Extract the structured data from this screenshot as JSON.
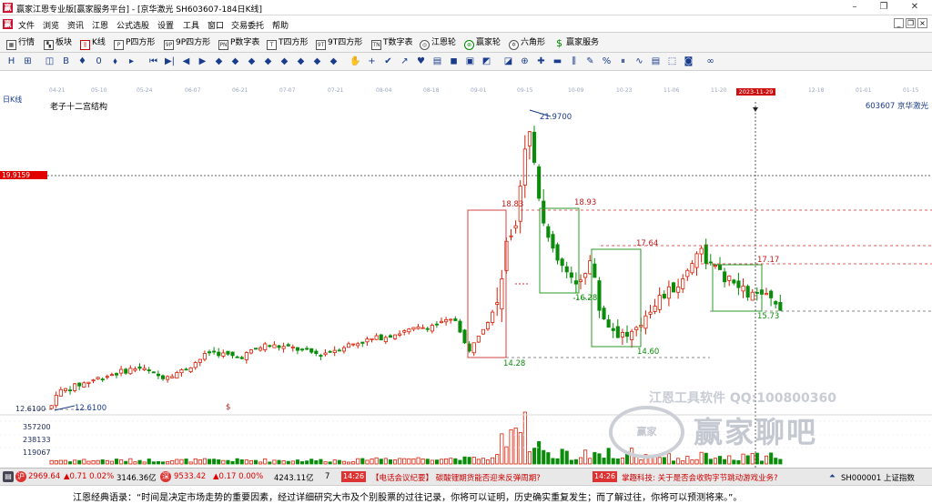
{
  "window": {
    "title": "赢家江恩专业版[赢家服务平台] - [京华激光  SH603607-184日K线]",
    "minimize": "–",
    "restore": "❐",
    "close": "✕"
  },
  "menu": {
    "items": [
      "文件",
      "浏览",
      "资讯",
      "江恩",
      "公式选股",
      "设置",
      "工具",
      "窗口",
      "交易委托",
      "帮助"
    ],
    "mdi_min": "_",
    "mdi_restore": "❐",
    "mdi_close": "×"
  },
  "toolbar1": {
    "items": [
      {
        "label": "行情",
        "icon": "grid-icon"
      },
      {
        "label": "板块",
        "icon": "blocks-icon"
      },
      {
        "label": "K线",
        "icon": "kline-icon"
      },
      {
        "label": "P四方形",
        "icon": "p-square-icon"
      },
      {
        "label": "9P四方形",
        "icon": "9p-square-icon"
      },
      {
        "label": "P数字表",
        "icon": "p-table-icon"
      },
      {
        "label": "T四方形",
        "icon": "t-square-icon"
      },
      {
        "label": "9T四方形",
        "icon": "9t-square-icon"
      },
      {
        "label": "T数字表",
        "icon": "t-table-icon"
      },
      {
        "label": "江恩轮",
        "icon": "gann-wheel-icon"
      },
      {
        "label": "赢家轮",
        "icon": "winner-wheel-icon"
      },
      {
        "label": "六角形",
        "icon": "hexagon-icon"
      },
      {
        "label": "赢家服务",
        "icon": "dollar-icon"
      }
    ]
  },
  "toolbar2": {
    "icons": [
      "H",
      "⊞",
      "◫",
      "B",
      "♦",
      "0",
      "⬧",
      "▸",
      "⏮",
      "▶|",
      "◀",
      "▶",
      "◆",
      "◆",
      "◆",
      "◆",
      "◆",
      "◆",
      "◆",
      "◆",
      "✋",
      "+",
      "✔",
      "↗",
      "♥",
      "▤",
      "◼",
      "▣",
      "◩",
      "◪",
      "⊕",
      "✚",
      "▬",
      "⫼",
      "✎",
      "%",
      "⏸",
      "∿",
      "▤",
      "⬚",
      "◙",
      "∞"
    ]
  },
  "date_axis": {
    "labels": [
      "04-21",
      "05-10",
      "05-24",
      "06-07",
      "06-21",
      "07-07",
      "07-21",
      "08-04",
      "08-18",
      "09-01",
      "09-15",
      "10-09",
      "10-23",
      "11-06",
      "11-20",
      "12-18",
      "01-01",
      "01-15"
    ],
    "highlight": "2023-11-29"
  },
  "chart": {
    "period_button": "日K线",
    "study_name": "老子十二宫结构",
    "stock": "603607 京华激光",
    "crosshair_price": "19.9159",
    "low_axis_label": "12.6100",
    "dollar_mark": "$",
    "price_labels": {
      "high": "21.9700",
      "low": "12.6100",
      "p1883": "18.83",
      "p1893": "18.93",
      "p1764": "17.64",
      "p1717": "17.17",
      "p1628": "16.28",
      "p1573": "15.73",
      "p1460": "14.60",
      "p1428": "14.28"
    },
    "volume_axis": [
      "357200",
      "238133",
      "119067"
    ]
  },
  "chart_data": {
    "type": "candlestick",
    "title": "老子十二宫结构",
    "y_range": [
      12.0,
      22.5
    ],
    "x_range_labels": [
      "04-21",
      "01-15"
    ],
    "key_levels": [
      21.97,
      19.9159,
      18.93,
      18.83,
      17.64,
      17.17,
      16.28,
      15.73,
      14.6,
      14.28,
      12.61
    ],
    "volume_ticks": [
      357200,
      238133,
      119067
    ],
    "trend": "rise from 12.61 (Apr) to 21.97 (Sep), pull back to ~15.7 (Nov-Dec)"
  },
  "watermark": {
    "line1": "江恩工具软件  QQ:100800360",
    "line2": "赢家聊吧",
    "logo": "赢家"
  },
  "statusbar": {
    "sh_index": "2969.64",
    "sh_change": "▲0.71 0.02%",
    "sh_amount": "3146.36亿",
    "sz_index": "9533.42",
    "sz_change": "▲0.17 0.00%",
    "sz_amount": "4243.11亿",
    "news_time1": "14:26",
    "news1": "【电话会议纪要】 碳酸锂期货能否迎来反弹周期?",
    "news_time2": "14:26",
    "news2": "掌趣科技: 关于是否会收购字节跳动游戏业务?",
    "index_code": "SH000001 上证指数",
    "left_icon": "▤",
    "mid_num": "7"
  },
  "quote": "江恩经典语录：“时间是决定市场走势的重要因素，经过详细研究大市及个别股票的过往记录，你将可以证明，历史确实重复发生；而了解过往，你将可以预测将来。”。",
  "colors": {
    "up": "#d81e06",
    "down": "#0a8c0a",
    "blue": "#1a3c8c",
    "marker": "#e00000"
  }
}
